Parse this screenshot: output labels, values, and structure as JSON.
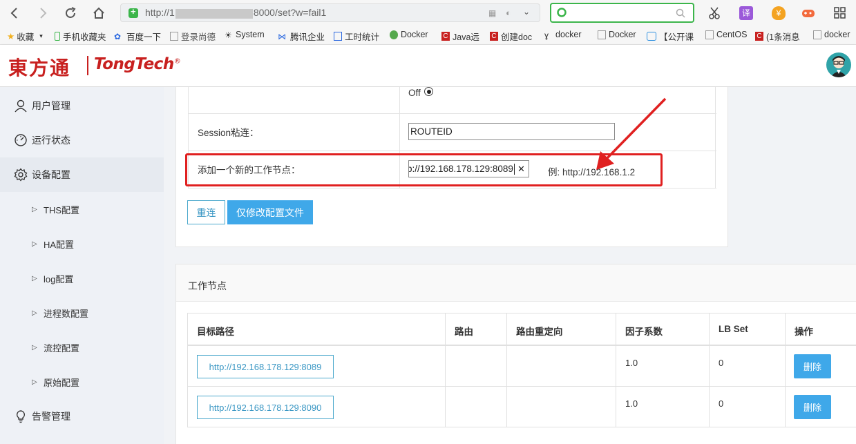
{
  "browser": {
    "url_prefix": "http://1",
    "url_suffix": "8000/set?w=fail1",
    "search_value": "",
    "bookmarks": [
      "收藏",
      "手机收藏夹",
      "百度一下",
      "登录尚德",
      "System",
      "腾讯企业",
      "工时统计",
      "Docker",
      "Java远",
      "创建doc",
      "docker",
      "Docker",
      "【公开课",
      "CentOS",
      "(1条消息",
      "docker"
    ]
  },
  "header": {
    "logo_cn": "東方通",
    "logo_en": "TongTech",
    "logo_reg": "®"
  },
  "sidebar": {
    "items": [
      {
        "label": "用户管理",
        "icon": "user-icon"
      },
      {
        "label": "运行状态",
        "icon": "gauge-icon"
      },
      {
        "label": "设备配置",
        "icon": "gear-icon"
      }
    ],
    "sub_items": [
      "THS配置",
      "HA配置",
      "log配置",
      "进程数配置",
      "流控配置",
      "原始配置"
    ],
    "bottom_item": {
      "label": "告警管理",
      "icon": "bulb-icon"
    }
  },
  "config": {
    "off_label": "Off",
    "session_label": "Session粘连：",
    "session_value": "ROUTEID",
    "add_node_label": "添加一个新的工作节点：",
    "add_node_value": "p://192.168.178.129:8089",
    "add_node_example": "例: http://192.168.1.2",
    "clear_glyph": "✕",
    "reconnect_label": "重连",
    "modify_config_label": "仅修改配置文件"
  },
  "nodes": {
    "panel_title": "工作节点",
    "columns": [
      "目标路径",
      "路由",
      "路由重定向",
      "因子系数",
      "LB Set",
      "操作"
    ],
    "rows": [
      {
        "target": "http://192.168.178.129:8089",
        "route": "",
        "redirect": "",
        "factor": "1.0",
        "lbset": "0",
        "action": "删除"
      },
      {
        "target": "http://192.168.178.129:8090",
        "route": "",
        "redirect": "",
        "factor": "1.0",
        "lbset": "0",
        "action": "删除"
      }
    ]
  },
  "colors": {
    "accent": "#3fa8e9",
    "highlight": "#e02020",
    "logo": "#c8201f"
  }
}
